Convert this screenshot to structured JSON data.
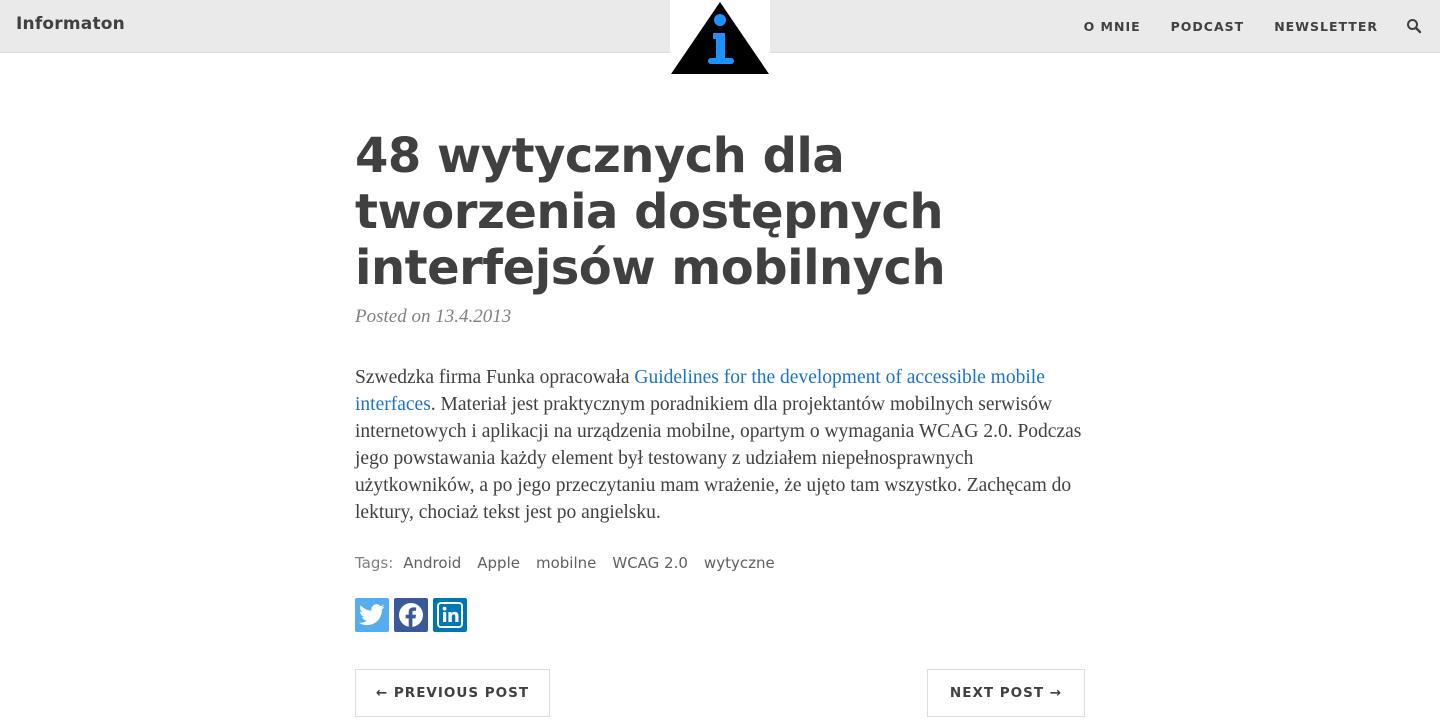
{
  "navbar": {
    "brand": "Informaton",
    "links": [
      "O MNIE",
      "PODCAST",
      "NEWSLETTER"
    ],
    "search_icon": "search-icon",
    "logo_icon": "info-triangle-logo-icon"
  },
  "post": {
    "title": "48 wytycznych dla tworzenia dostępnych interfejsów mobilnych",
    "meta": "Posted on 13.4.2013",
    "body_before_link": "Szwedzka firma Funka opracowała ",
    "link_text": "Guidelines for the development of accessible mobile interfaces",
    "body_after_link": ". Materiał jest praktycznym poradnikiem dla projektantów mobilnych serwisów internetowych i aplikacji na urządzenia mobilne, opartym o wymagania WCAG 2.0. Podczas jego powstawania każdy element był testowany z udziałem niepełnosprawnych użytkowników, a po jego przeczytaniu mam wrażenie, że ujęto tam wszystko. Zachęcam do lektury, chociaż tekst jest po angielsku.",
    "tags_label": "Tags:",
    "tags": [
      "Android",
      "Apple",
      "mobilne",
      "WCAG 2.0",
      "wytyczne"
    ]
  },
  "share": {
    "twitter_icon": "twitter-icon",
    "facebook_icon": "facebook-icon",
    "linkedin_icon": "linkedin-icon",
    "colors": {
      "twitter": "#55acee",
      "facebook": "#3b5998",
      "linkedin": "#0077b5"
    }
  },
  "pager": {
    "prev_label": "← PREVIOUS POST",
    "next_label": "NEXT POST →"
  },
  "colors": {
    "link": "#1a73c9",
    "text": "#404040",
    "navbar_bg": "#eaeaea",
    "logo_blue": "#1e90ff"
  }
}
